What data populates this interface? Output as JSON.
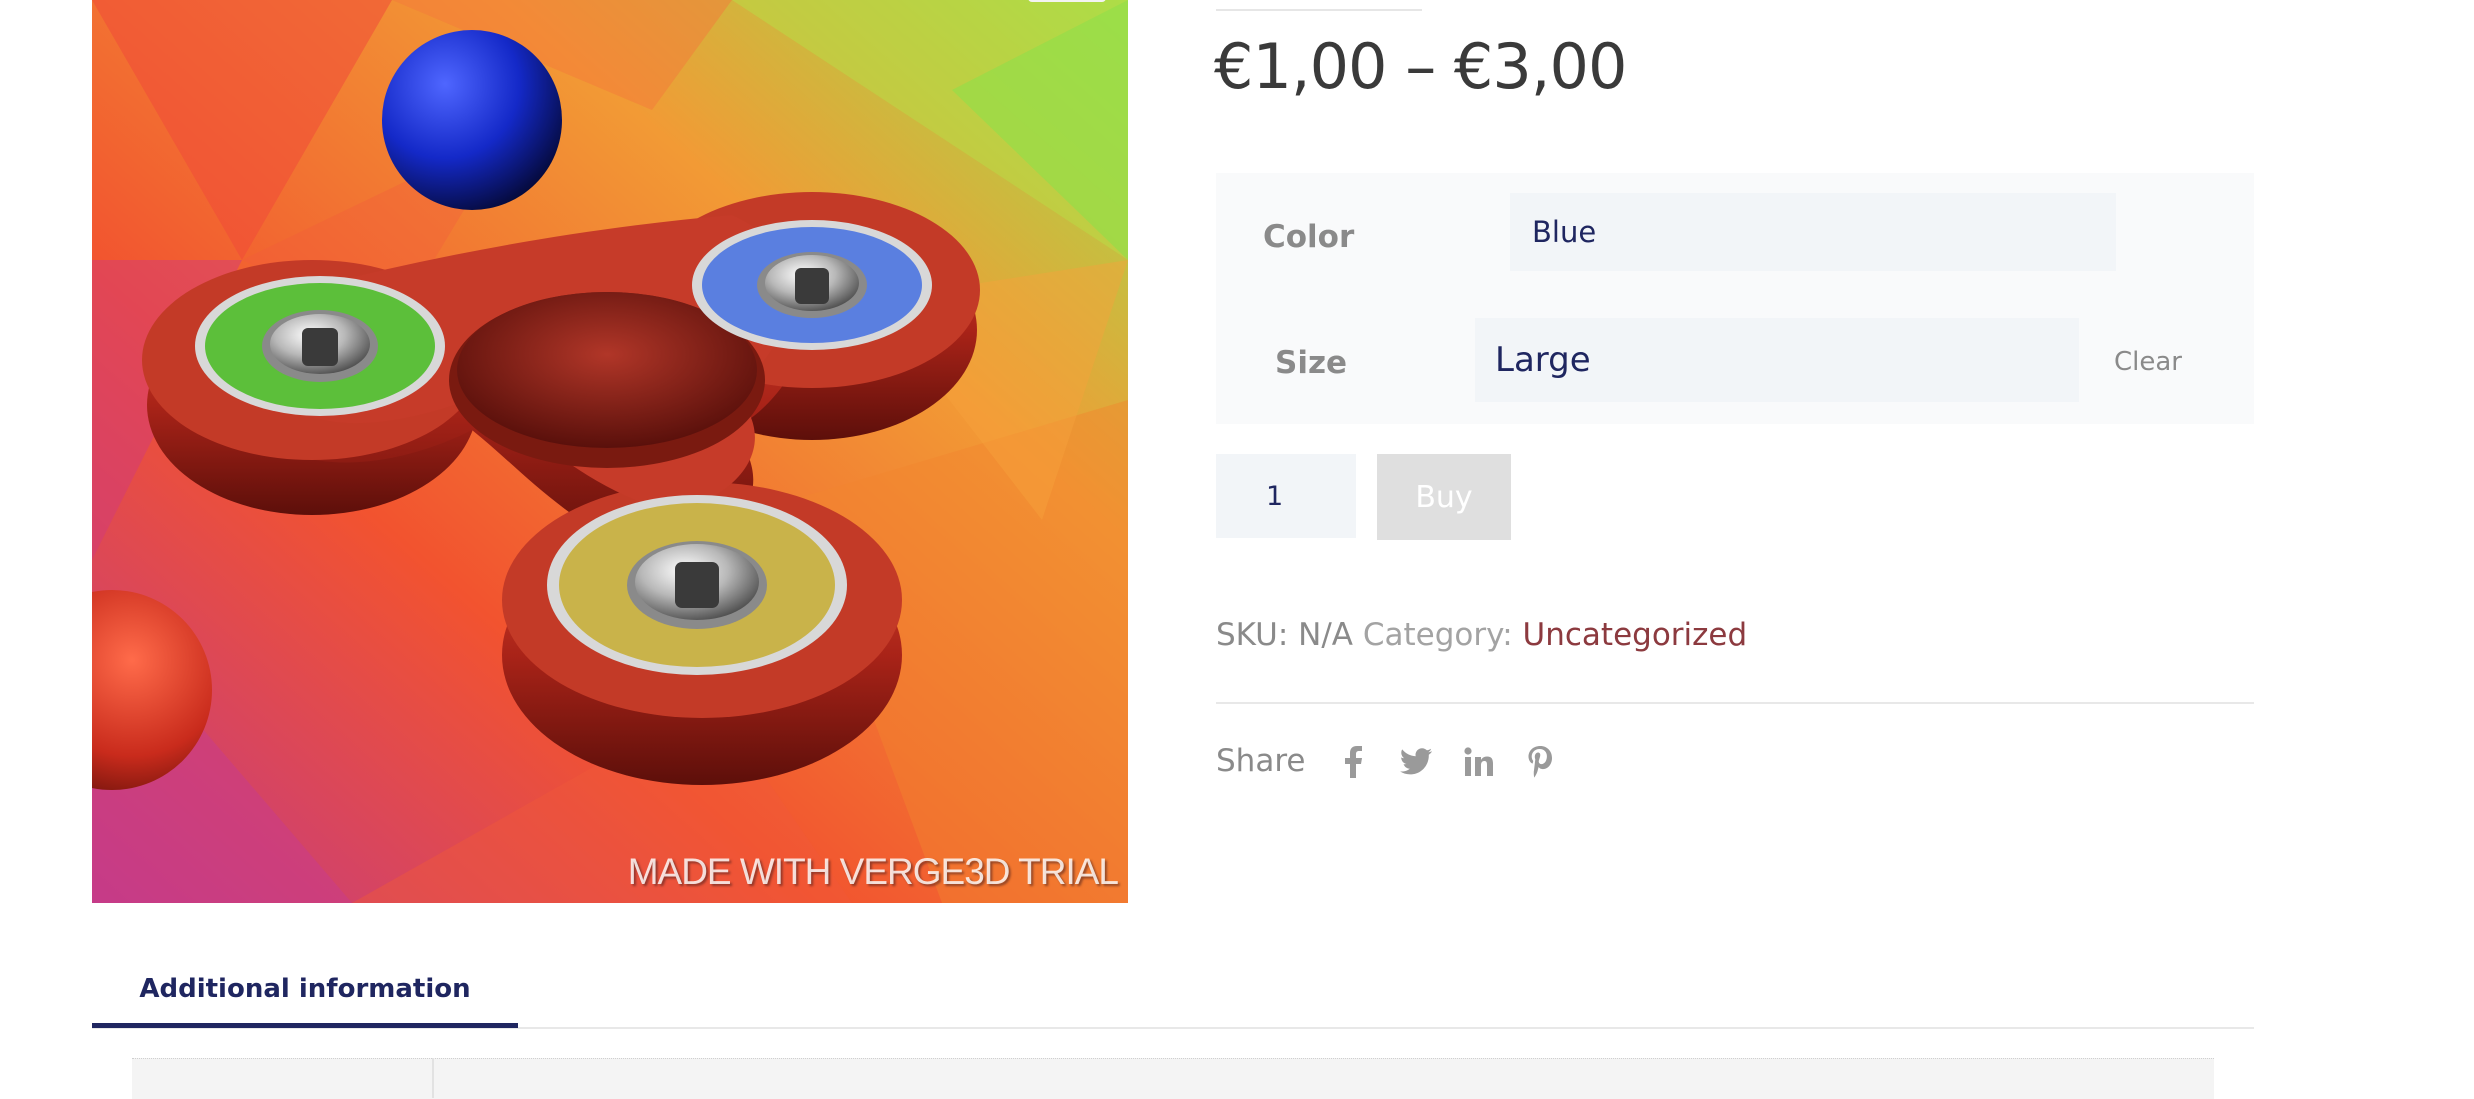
{
  "product_image": {
    "watermark": "MADE WITH VERGE3D TRIAL"
  },
  "price": {
    "text": "€1,00 – €3,00"
  },
  "variations": {
    "color": {
      "label": "Color",
      "value": "Blue"
    },
    "size": {
      "label": "Size",
      "value": "Large"
    },
    "clear_label": "Clear"
  },
  "cart": {
    "quantity": "1",
    "buy_label": "Buy"
  },
  "meta": {
    "sku_label": "SKU:",
    "sku_value": "N/A",
    "category_label": "Category:",
    "category_value": "Uncategorized"
  },
  "share": {
    "label": "Share",
    "icons": [
      "facebook-icon",
      "twitter-icon",
      "linkedin-icon",
      "pinterest-icon"
    ]
  },
  "tabs": [
    {
      "label": "Additional information",
      "active": true
    }
  ],
  "colors": {
    "accent_navy": "#1f2660",
    "category_link": "#8c3a3f",
    "muted_text": "#8a8a8a",
    "buy_disabled": "#dfdfdf"
  }
}
